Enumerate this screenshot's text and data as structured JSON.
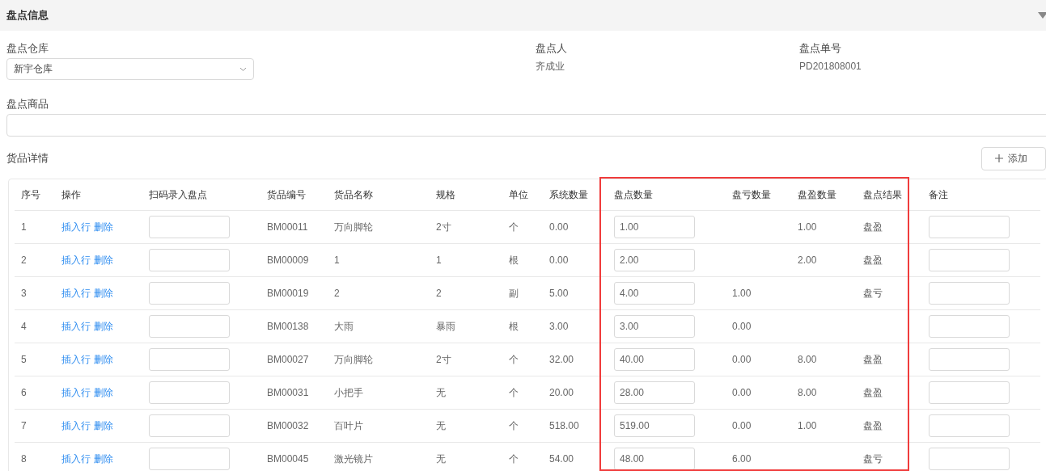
{
  "section": {
    "title": "盘点信息",
    "collapsed": false
  },
  "fields": {
    "warehouse": {
      "label": "盘点仓库",
      "value": "新宇仓库"
    },
    "person": {
      "label": "盘点人",
      "value": "齐成业"
    },
    "number": {
      "label": "盘点单号",
      "value": "PD201808001"
    },
    "goods": {
      "label": "盘点商品"
    }
  },
  "details": {
    "label": "货品详情",
    "add_button": "添加"
  },
  "table": {
    "columns": [
      {
        "label": "序号",
        "highlighted": false
      },
      {
        "label": "操作",
        "highlighted": false
      },
      {
        "label": "扫码录入盘点",
        "highlighted": false
      },
      {
        "label": "货品编号",
        "highlighted": false
      },
      {
        "label": "货品名称",
        "highlighted": false
      },
      {
        "label": "规格",
        "highlighted": false
      },
      {
        "label": "单位",
        "highlighted": false
      },
      {
        "label": "系统数量",
        "highlighted": false
      },
      {
        "label": "盘点数量",
        "highlighted": true
      },
      {
        "label": "盘亏数量",
        "highlighted": true
      },
      {
        "label": "盘盈数量",
        "highlighted": true
      },
      {
        "label": "盘点结果",
        "highlighted": true
      },
      {
        "label": "备注",
        "highlighted": false
      }
    ],
    "rows": [
      {
        "seq": "1",
        "actions": [
          "插入行",
          "删除"
        ],
        "code": "BM00011",
        "name": "万向脚轮",
        "spec": "2寸",
        "unit": "个",
        "system_qty": "0.00",
        "count_qty": "1.00",
        "loss": "",
        "gain": "1.00",
        "result": "盘盈"
      },
      {
        "seq": "2",
        "actions": [
          "插入行",
          "删除"
        ],
        "code": "BM00009",
        "name": "1",
        "spec": "1",
        "unit": "根",
        "system_qty": "0.00",
        "count_qty": "2.00",
        "loss": "",
        "gain": "2.00",
        "result": "盘盈"
      },
      {
        "seq": "3",
        "actions": [
          "插入行",
          "删除"
        ],
        "code": "BM00019",
        "name": "2",
        "spec": "2",
        "unit": "副",
        "system_qty": "5.00",
        "count_qty": "4.00",
        "loss": "1.00",
        "gain": "",
        "result": "盘亏"
      },
      {
        "seq": "4",
        "actions": [
          "插入行",
          "删除"
        ],
        "code": "BM00138",
        "name": "大雨",
        "spec": "暴雨",
        "unit": "根",
        "system_qty": "3.00",
        "count_qty": "3.00",
        "loss": "0.00",
        "gain": "",
        "result": ""
      },
      {
        "seq": "5",
        "actions": [
          "插入行",
          "删除"
        ],
        "code": "BM00027",
        "name": "万向脚轮",
        "spec": "2寸",
        "unit": "个",
        "system_qty": "32.00",
        "count_qty": "40.00",
        "loss": "0.00",
        "gain": "8.00",
        "result": "盘盈"
      },
      {
        "seq": "6",
        "actions": [
          "插入行",
          "删除"
        ],
        "code": "BM00031",
        "name": "小把手",
        "spec": "无",
        "unit": "个",
        "system_qty": "20.00",
        "count_qty": "28.00",
        "loss": "0.00",
        "gain": "8.00",
        "result": "盘盈"
      },
      {
        "seq": "7",
        "actions": [
          "插入行",
          "删除"
        ],
        "code": "BM00032",
        "name": "百叶片",
        "spec": "无",
        "unit": "个",
        "system_qty": "518.00",
        "count_qty": "519.00",
        "loss": "0.00",
        "gain": "1.00",
        "result": "盘盈"
      },
      {
        "seq": "8",
        "actions": [
          "插入行",
          "删除"
        ],
        "code": "BM00045",
        "name": "激光镜片",
        "spec": "无",
        "unit": "个",
        "system_qty": "54.00",
        "count_qty": "48.00",
        "loss": "6.00",
        "gain": "",
        "result": "盘亏"
      }
    ]
  }
}
